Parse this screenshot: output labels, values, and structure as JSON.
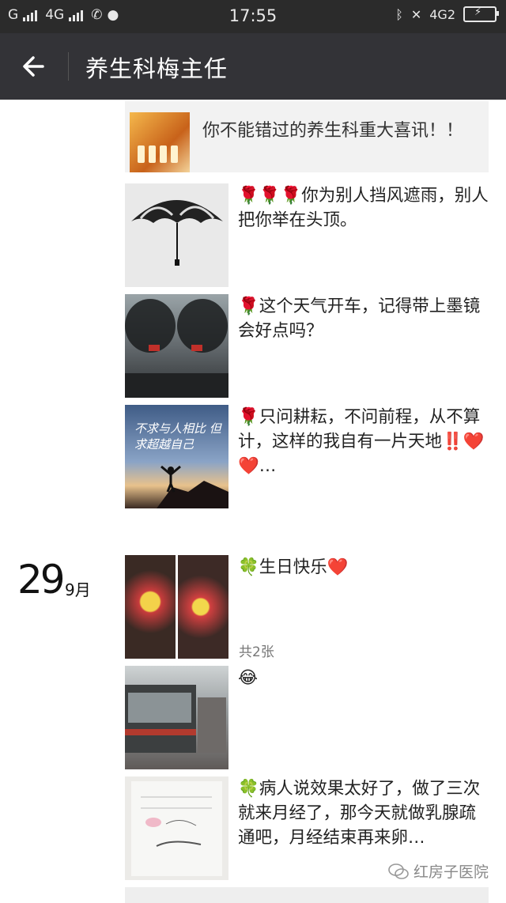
{
  "status": {
    "carrier_label": "G",
    "network_label": "4G",
    "time": "17:55",
    "right_network_label": "4G2"
  },
  "header": {
    "title": "养生科梅主任"
  },
  "feed": {
    "shared_link": {
      "text": "你不能错过的养生科重大喜讯！！"
    },
    "posts": [
      {
        "text": "🌹🌹🌹你为别人挡风遮雨，别人把你举在头顶。"
      },
      {
        "text": "🌹这个天气开车，记得带上墨镜会好点吗？"
      },
      {
        "text": "🌹只问耕耘，不问前程，从不算计，这样的我自有一片天地‼️❤️❤️…",
        "image_text": "不求与人相比 但求超越自己"
      },
      {
        "text": "🍀生日快乐❤️",
        "count": "共2张"
      },
      {
        "text": "😂"
      },
      {
        "text": "🍀病人说效果太好了，做了三次就来月经了，那今天就做乳腺疏通吧，月经结束再来卵…"
      }
    ],
    "date": {
      "day": "29",
      "month": "9月"
    }
  },
  "watermark": {
    "text": "红房子医院"
  },
  "colors": {
    "status_bg": "#2b2b2b",
    "title_bg": "#333337",
    "shared_bg": "#f2f2f2"
  }
}
